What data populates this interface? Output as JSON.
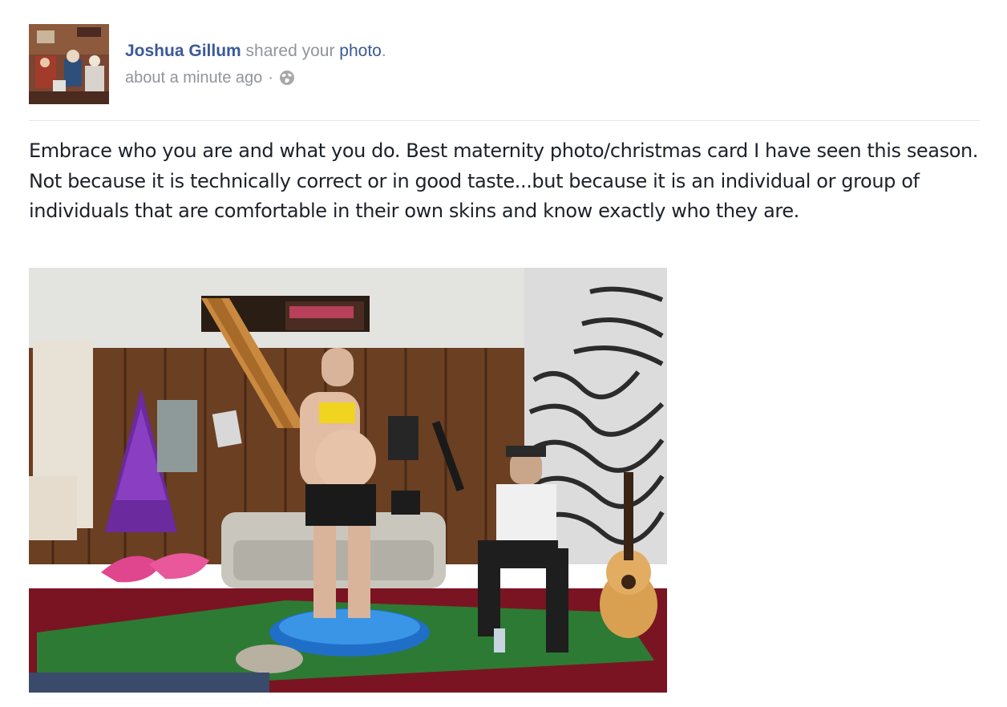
{
  "story": {
    "actor_name": "Joshua Gillum",
    "action_text": "shared your",
    "object_link": "photo",
    "object_suffix": ".",
    "timestamp": "about a minute ago",
    "separator": "·",
    "privacy_icon": "globe-icon"
  },
  "message": "Embrace who you are and what you do. Best maternity photo/christmas card I have seen this season. Not because it is technically correct or in good taste...but because it is an individual or group of individuals that are comfortable in their own skins and know exactly who they are.",
  "colors": {
    "link": "#3b5998",
    "meta_text": "#90949c",
    "body_text": "#1d2129",
    "divider": "#e5e5e5"
  }
}
